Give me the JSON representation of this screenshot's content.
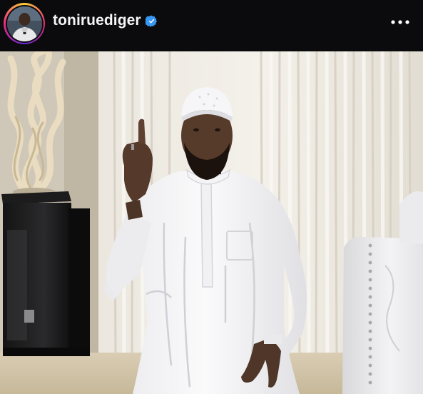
{
  "post": {
    "username": "toniruediger",
    "verified": true,
    "more_icon": "ellipsis-horizontal-icon",
    "avatar_icon": "profile-avatar",
    "verified_icon": "verified-badge-icon"
  },
  "colors": {
    "header_bg": "#0b0b0d",
    "username": "#f5f5f5",
    "verified_blue": "#3897f0"
  }
}
